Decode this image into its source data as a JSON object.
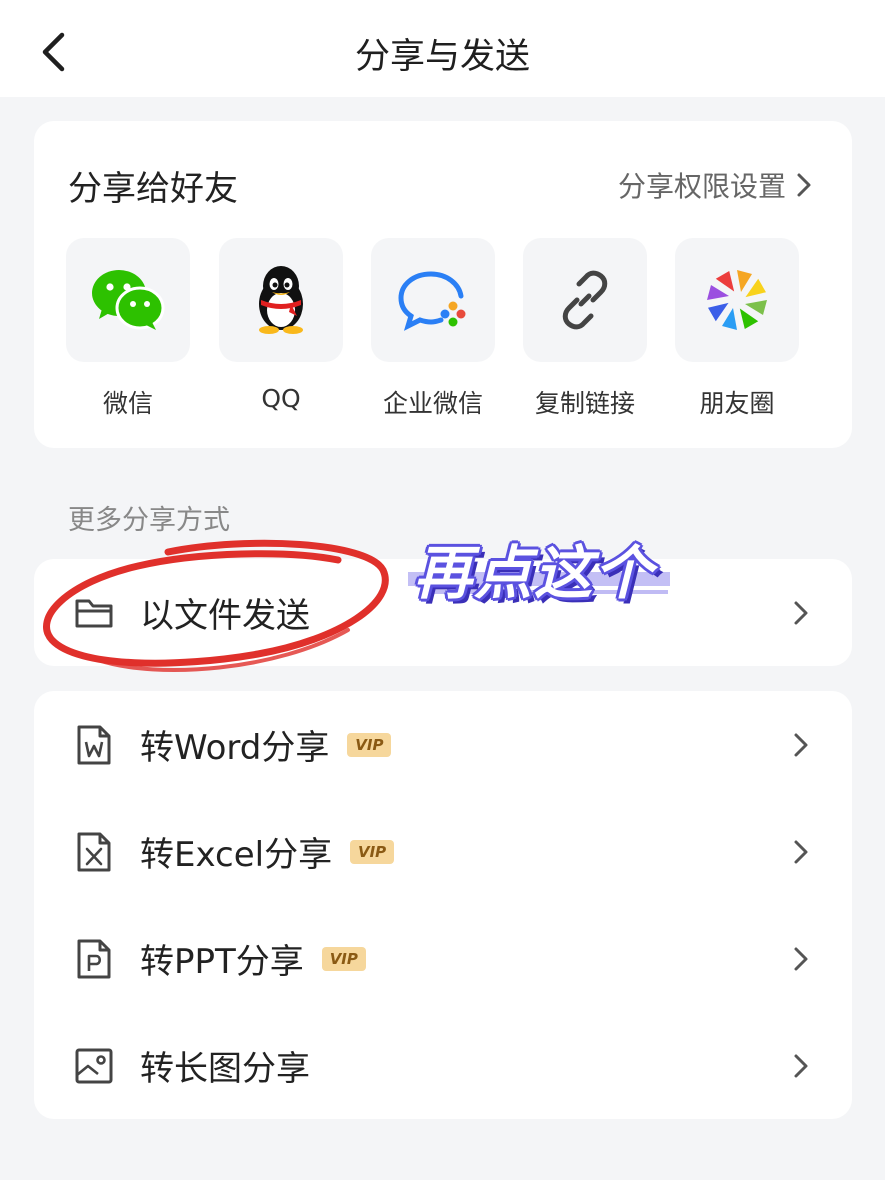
{
  "header": {
    "title": "分享与发送",
    "back_icon": "chevron-left-icon"
  },
  "share_friends": {
    "title": "分享给好友",
    "permission_link": "分享权限设置",
    "items": [
      {
        "label": "微信",
        "icon": "wechat-icon"
      },
      {
        "label": "QQ",
        "icon": "qq-icon"
      },
      {
        "label": "企业微信",
        "icon": "wecom-icon"
      },
      {
        "label": "复制链接",
        "icon": "link-icon"
      },
      {
        "label": "朋友圈",
        "icon": "moments-icon"
      }
    ]
  },
  "more_share": {
    "section_label": "更多分享方式",
    "send_as_file": {
      "label": "以文件发送",
      "icon": "folder-icon"
    },
    "convert_items": [
      {
        "label": "转Word分享",
        "vip": "VIP",
        "icon": "word-file-icon"
      },
      {
        "label": "转Excel分享",
        "vip": "VIP",
        "icon": "excel-file-icon"
      },
      {
        "label": "转PPT分享",
        "vip": "VIP",
        "icon": "ppt-file-icon"
      },
      {
        "label": "转长图分享",
        "vip": "",
        "icon": "long-image-icon"
      }
    ]
  },
  "annotation": {
    "text": "再点这个",
    "circle_color": "#e0302b",
    "text_color": "#5b52e0"
  },
  "colors": {
    "wechat": "#2dc100",
    "vip_bg": "#f6d79c",
    "vip_text": "#8a5a14",
    "background": "#f4f5f7"
  }
}
